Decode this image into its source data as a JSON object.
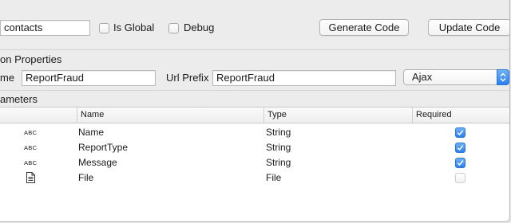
{
  "toolbar": {
    "name_value": "contacts",
    "is_global_label": "Is Global",
    "is_global_checked": false,
    "debug_label": "Debug",
    "debug_checked": false,
    "generate_button": "Generate Code",
    "update_button": "Update Code"
  },
  "properties": {
    "section_label": "on Properties",
    "name_label": "me",
    "name_value": "ReportFraud",
    "url_prefix_label": "Url Prefix",
    "url_prefix_value": "ReportFraud",
    "method_selected": "Ajax"
  },
  "parameters": {
    "section_label": "ameters",
    "columns": [
      "Name",
      "Type",
      "Required"
    ],
    "rows": [
      {
        "icon": "abc-icon",
        "icon_text": "ABC",
        "name": "Name",
        "type": "String",
        "required": true
      },
      {
        "icon": "abc-icon",
        "icon_text": "ABC",
        "name": "ReportType",
        "type": "String",
        "required": true
      },
      {
        "icon": "abc-icon",
        "icon_text": "ABC",
        "name": "Message",
        "type": "String",
        "required": true
      },
      {
        "icon": "document-icon",
        "icon_text": "",
        "name": "File",
        "type": "File",
        "required": false
      }
    ]
  },
  "colors": {
    "accent": "#2a7ff0",
    "window_bg": "#ececec",
    "table_bg": "#ffffff"
  }
}
